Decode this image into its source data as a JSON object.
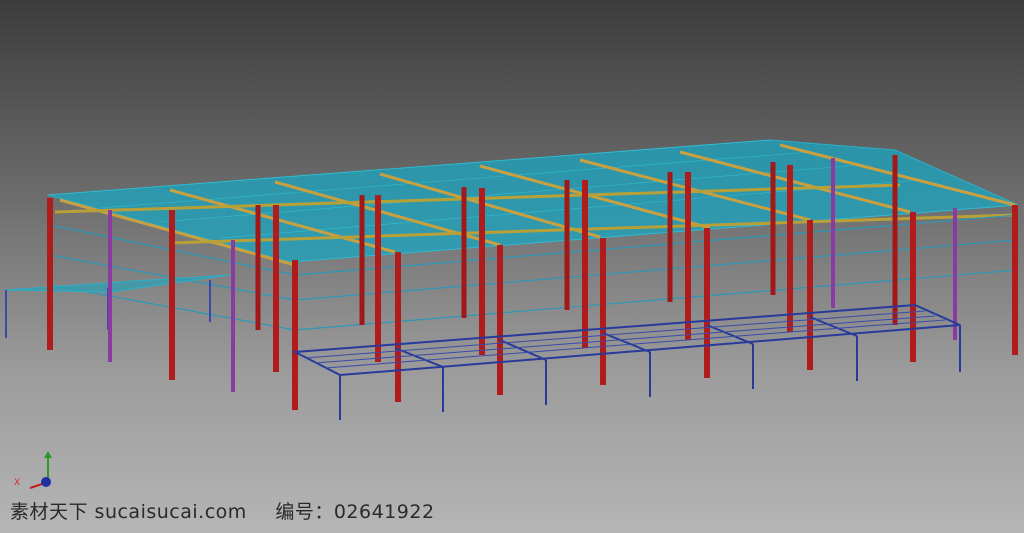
{
  "viewport": {
    "content": "3D steel frame structure model",
    "colors": {
      "column": "#a01818",
      "column_alt": "#8a3aa0",
      "rafter": "#c8a040",
      "purlin": "#2ab0c8",
      "roof_panel": "#1aa5c0",
      "platform_frame": "#283a9a",
      "bracing": "#3a4aa8"
    }
  },
  "axis": {
    "x_label": "X"
  },
  "watermark": {
    "site_text": "素材天下 sucaisucai.com",
    "id_text": "编号：02641922"
  }
}
